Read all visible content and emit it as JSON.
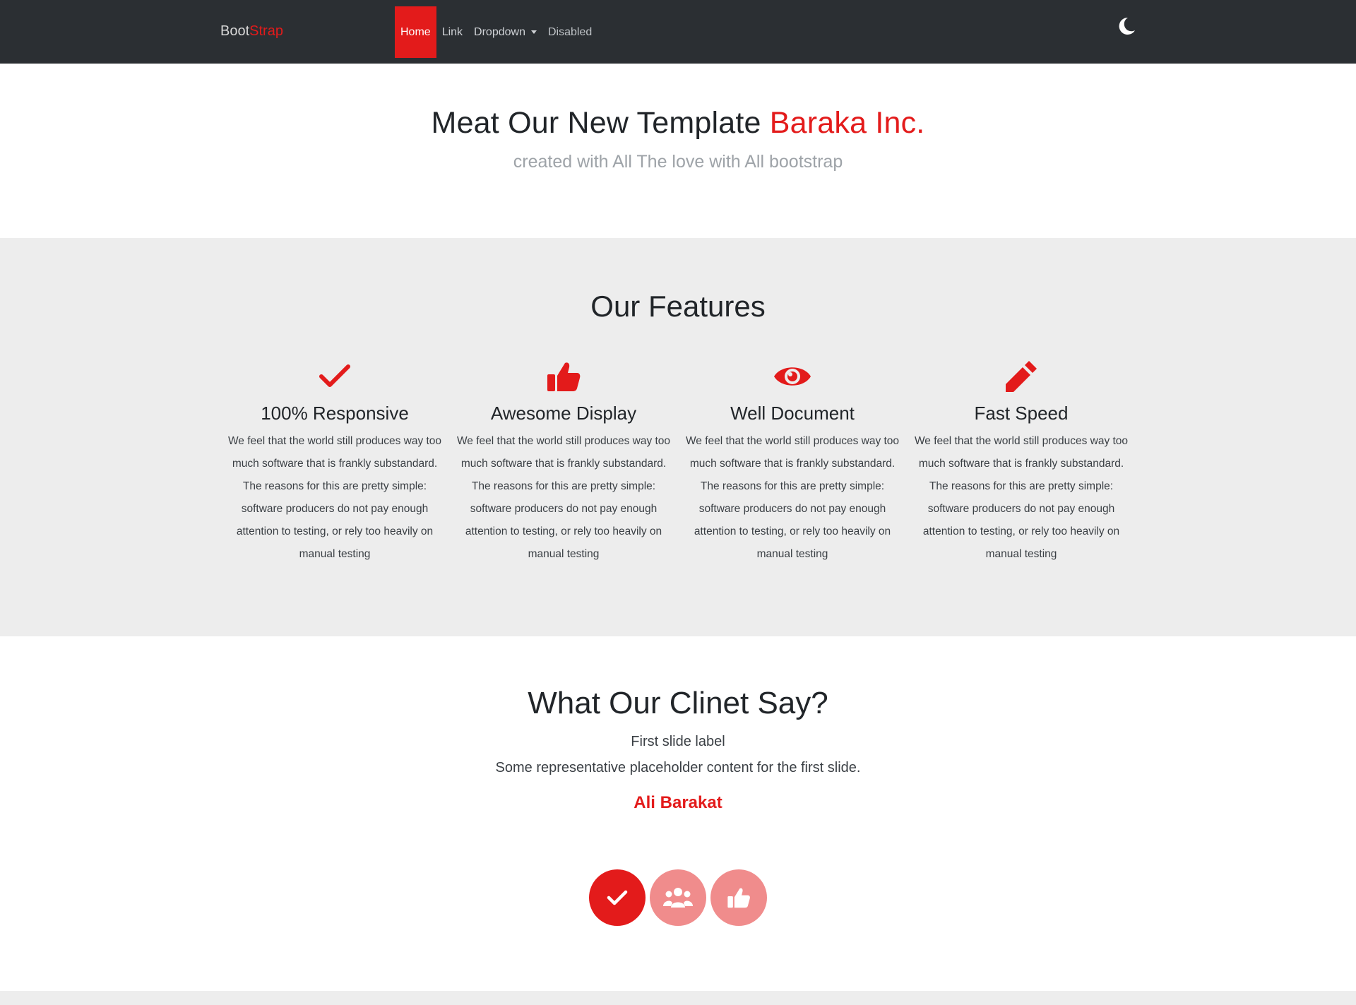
{
  "navbar": {
    "brand_part1": "Boot",
    "brand_part2": "Strap",
    "items": [
      {
        "label": "Home"
      },
      {
        "label": "Link"
      },
      {
        "label": "Dropdown"
      },
      {
        "label": "Disabled"
      }
    ],
    "theme_icon": "moon-icon"
  },
  "hero": {
    "title_part1": "Meat Our New Template ",
    "title_part2": "Baraka Inc.",
    "subtitle": "created with All The love with All bootstrap"
  },
  "features": {
    "title": "Our Features",
    "items": [
      {
        "icon": "check-icon",
        "title": "100% Responsive",
        "text": "We feel that the world still produces way too much software that is frankly substandard. The reasons for this are pretty simple: software producers do not pay enough attention to testing, or rely too heavily on manual testing"
      },
      {
        "icon": "thumbs-up-icon",
        "title": "Awesome Display",
        "text": "We feel that the world still produces way too much software that is frankly substandard. The reasons for this are pretty simple: software producers do not pay enough attention to testing, or rely too heavily on manual testing"
      },
      {
        "icon": "eye-icon",
        "title": "Well Document",
        "text": "We feel that the world still produces way too much software that is frankly substandard. The reasons for this are pretty simple: software producers do not pay enough attention to testing, or rely too heavily on manual testing"
      },
      {
        "icon": "pencil-icon",
        "title": "Fast Speed",
        "text": "We feel that the world still produces way too much software that is frankly substandard. The reasons for this are pretty simple: software producers do not pay enough attention to testing, or rely too heavily on manual testing"
      }
    ]
  },
  "testimonial": {
    "title": "What Our Clinet Say?",
    "slide_label": "First slide label",
    "slide_content": "Some representative placeholder content for the first slide.",
    "author": "Ali Barakat",
    "indicators": [
      "check-icon",
      "users-icon",
      "thumbs-up-icon"
    ]
  },
  "colors": {
    "accent": "#e31b1b",
    "accent_light": "#f08c8c",
    "navbar_bg": "#2b2f33",
    "section_bg": "#ededed"
  }
}
